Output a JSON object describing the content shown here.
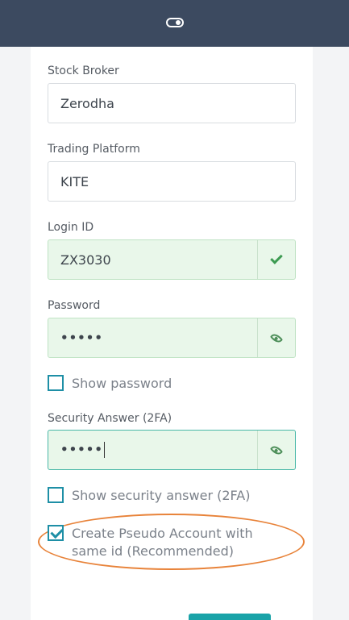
{
  "form": {
    "stock_broker": {
      "label": "Stock Broker",
      "value": "Zerodha"
    },
    "trading_platform": {
      "label": "Trading Platform",
      "value": "KITE"
    },
    "login_id": {
      "label": "Login ID",
      "value": "ZX3030"
    },
    "password": {
      "label": "Password",
      "value": "•••••"
    },
    "show_password": {
      "label": "Show password",
      "checked": false
    },
    "security_answer": {
      "label": "Security Answer (2FA)",
      "value": "•••••"
    },
    "show_security_answer": {
      "label": "Show security answer (2FA)",
      "checked": false
    },
    "pseudo_account": {
      "label_line1": "Create Pseudo Account with",
      "label_line2": "same id (Recommended)",
      "checked": true
    }
  },
  "icons": {
    "topbar": "toggle-icon",
    "login_valid": "checkmark-icon",
    "password_reveal": "eye-icon",
    "security_reveal": "eye-icon"
  },
  "colors": {
    "topbar": "#3c4a60",
    "valid_bg": "#e9f7ea",
    "accent": "#1e8fa6",
    "highlight": "#e8833a"
  }
}
